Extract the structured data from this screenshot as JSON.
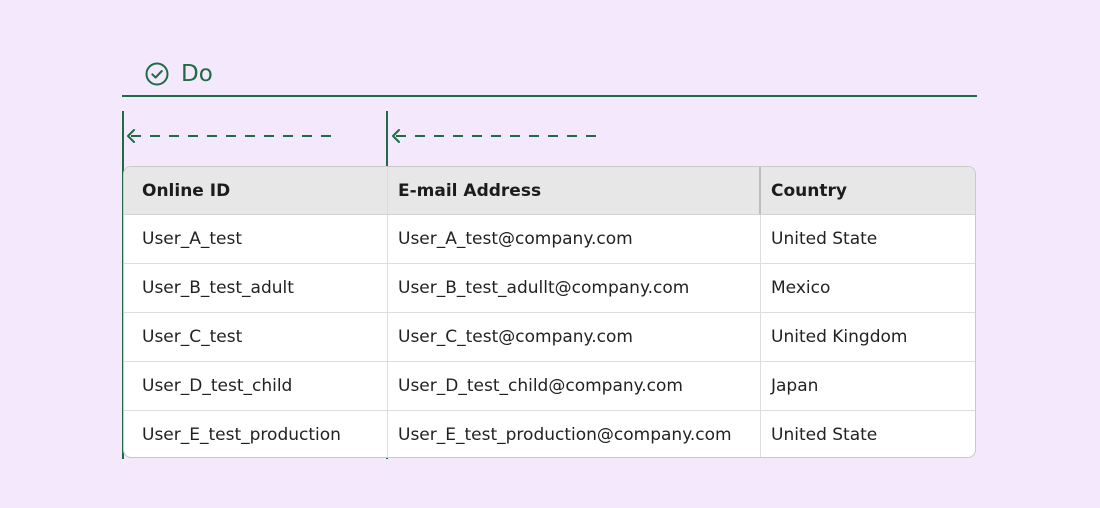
{
  "heading": {
    "icon": "check-circle-icon",
    "label": "Do"
  },
  "colors": {
    "accent": "#1e6b45",
    "background": "#f4e9fc",
    "header_bg": "#e7e7e7"
  },
  "table": {
    "headers": [
      "Online ID",
      "E-mail Address",
      "Country"
    ],
    "rows": [
      [
        "User_A_test",
        "User_A_test@company.com",
        "United State"
      ],
      [
        "User_B_test_adult",
        "User_B_test_adullt@company.com",
        "Mexico"
      ],
      [
        "User_C_test",
        "User_C_test@company.com",
        "United Kingdom"
      ],
      [
        "User_D_test_child",
        "User_D_test_child@company.com",
        "Japan"
      ],
      [
        "User_E_test_production",
        "User_E_test_production@company.com",
        "United State"
      ]
    ]
  }
}
